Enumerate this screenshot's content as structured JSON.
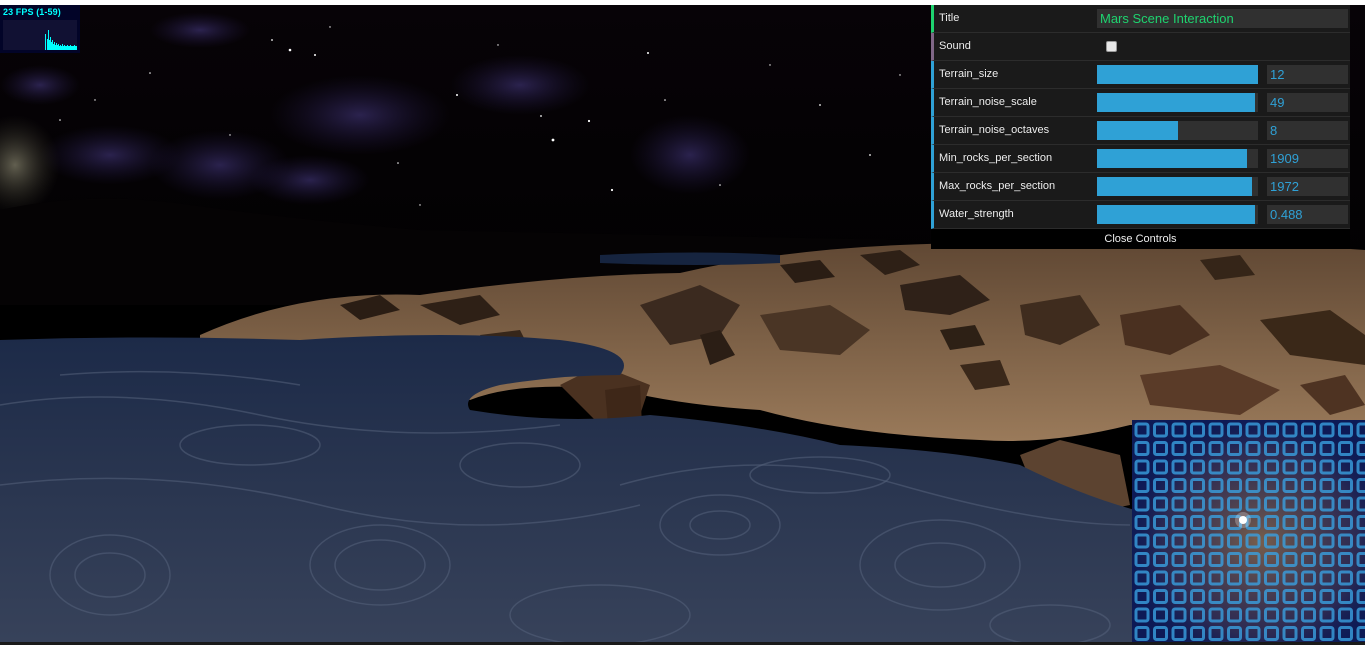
{
  "stats": {
    "label": "23 FPS (1-59)"
  },
  "gui": {
    "title_row": {
      "label": "Title",
      "value": "Mars Scene Interaction"
    },
    "sound_row": {
      "label": "Sound",
      "checked": false
    },
    "sliders": [
      {
        "label": "Terrain_size",
        "value": "12",
        "fill": 1.0
      },
      {
        "label": "Terrain_noise_scale",
        "value": "49",
        "fill": 0.98
      },
      {
        "label": "Terrain_noise_octaves",
        "value": "8",
        "fill": 0.5
      },
      {
        "label": "Min_rocks_per_section",
        "value": "1909",
        "fill": 0.93
      },
      {
        "label": "Max_rocks_per_section",
        "value": "1972",
        "fill": 0.96
      },
      {
        "label": "Water_strength",
        "value": "0.488",
        "fill": 0.98
      }
    ],
    "close_label": "Close Controls"
  },
  "colors": {
    "number_accent": "#2fa1d6",
    "string_accent": "#1ed36f",
    "bool_accent": "#806787",
    "fps_text": "#00ffff"
  }
}
